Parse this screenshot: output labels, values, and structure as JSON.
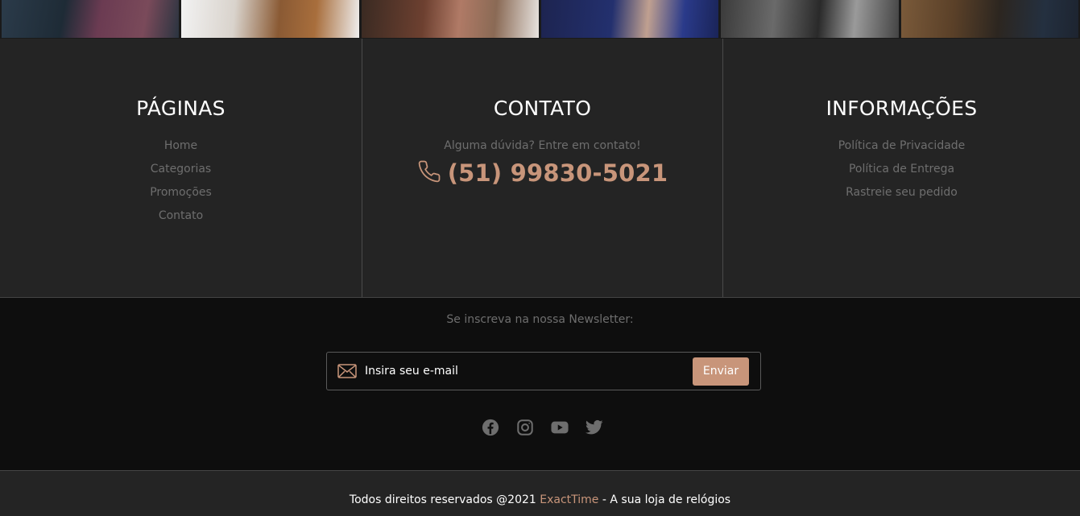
{
  "gallery": {
    "images": [
      "wrist-photo-1",
      "wrist-photo-2",
      "wrist-photo-3",
      "wrist-photo-4",
      "wrist-photo-5",
      "wrist-photo-6"
    ]
  },
  "footer": {
    "pages": {
      "title": "PÁGINAS",
      "links": [
        "Home",
        "Categorias",
        "Promoções",
        "Contato"
      ]
    },
    "contact": {
      "title": "CONTATO",
      "question": "Alguma dúvida? Entre em contato!",
      "phone": "(51) 99830-5021",
      "phone_icon": "phone-icon"
    },
    "info": {
      "title": "INFORMAÇÕES",
      "links": [
        "Política de Privacidade",
        "Política de Entrega",
        "Rastreie seu pedido"
      ]
    }
  },
  "newsletter": {
    "title": "Se inscreva na nossa Newsletter:",
    "placeholder": "Insira seu e-mail",
    "button": "Enviar",
    "icon": "envelope-icon"
  },
  "socials": [
    "facebook-icon",
    "instagram-icon",
    "youtube-icon",
    "twitter-icon"
  ],
  "copyright": {
    "prefix": "Todos direitos reservados @2021 ",
    "brand": "ExactTime",
    "suffix": " - A sua loja de relógios"
  },
  "colors": {
    "accent": "#c8957a",
    "muted": "#6e6e6e",
    "dark": "#242424",
    "darker": "#0e0e0e"
  }
}
